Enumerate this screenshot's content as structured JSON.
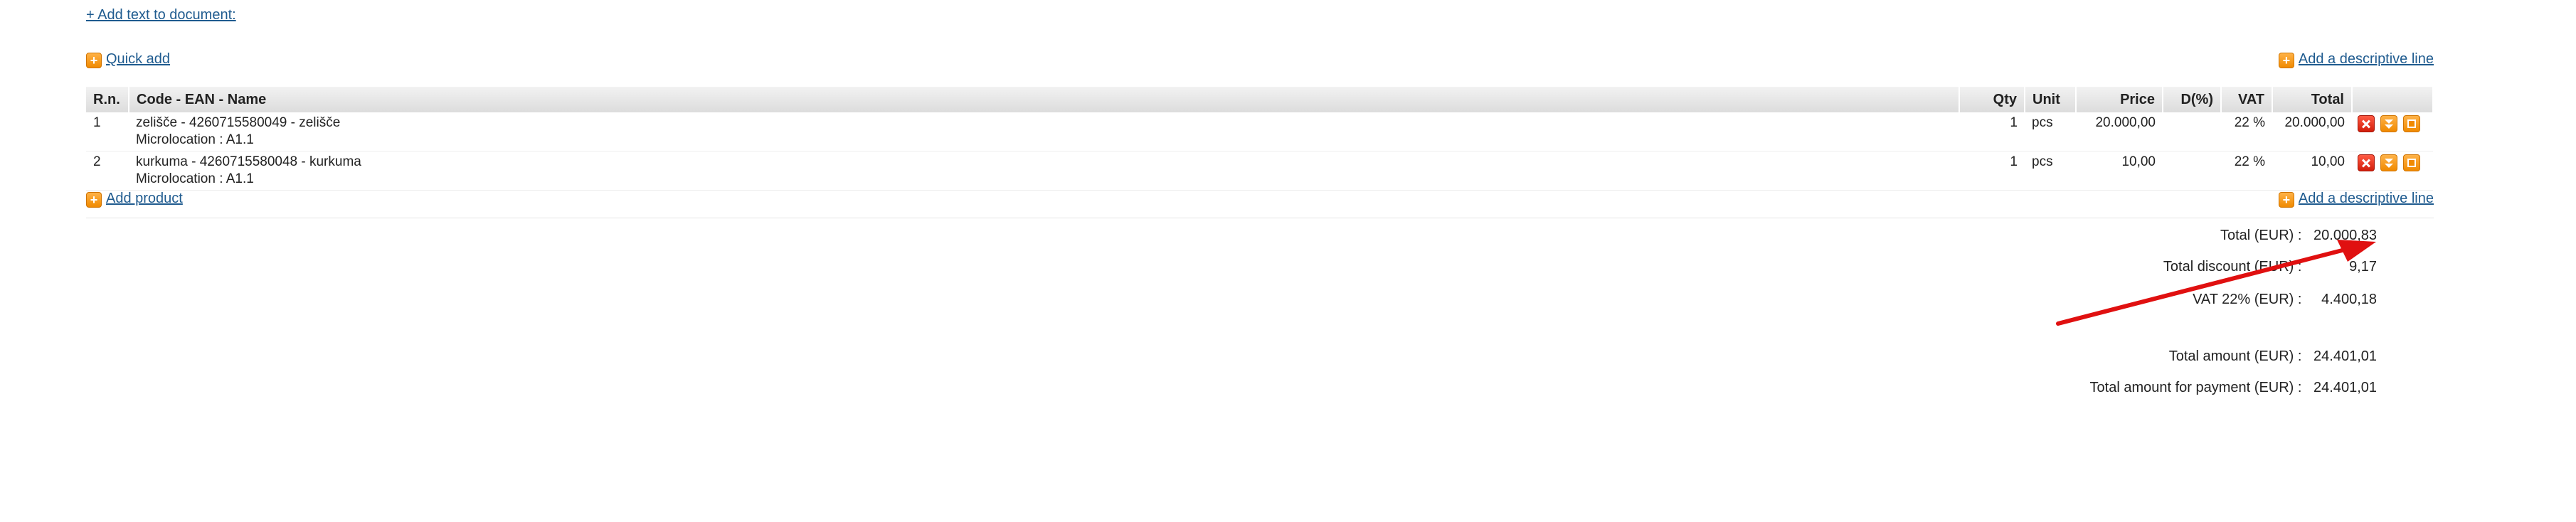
{
  "links": {
    "add_text": "+ Add text to document:",
    "quick_add": "Quick add",
    "add_descriptive_line": "Add a descriptive line",
    "add_product": "Add product"
  },
  "table": {
    "headers": [
      "R.n.",
      "Code - EAN - Name",
      "Qty",
      "Unit",
      "Price",
      "D(%)",
      "VAT",
      "Total"
    ],
    "rows": [
      {
        "rn": "1",
        "name": "zelišče - 4260715580049 - zelišče",
        "microlocation": "Microlocation : A1.1",
        "qty": "1",
        "unit": "pcs",
        "price": "20.000,00",
        "discount": "",
        "vat": "22 %",
        "total": "20.000,00"
      },
      {
        "rn": "2",
        "name": "kurkuma - 4260715580048 - kurkuma",
        "microlocation": "Microlocation : A1.1",
        "qty": "1",
        "unit": "pcs",
        "price": "10,00",
        "discount": "",
        "vat": "22 %",
        "total": "10,00"
      }
    ]
  },
  "totals": {
    "total_label": "Total (EUR) :",
    "total_value": "20.000,83",
    "discount_label": "Total discount (EUR) :",
    "discount_value": "9,17",
    "vat_label": "VAT 22% (EUR) :",
    "vat_value": "4.400,18",
    "amount_label": "Total amount (EUR) :",
    "amount_value": "24.401,01",
    "payment_label": "Total amount for payment (EUR) :",
    "payment_value": "24.401,01"
  },
  "icons": {
    "add": "plus-icon",
    "delete": "delete-icon",
    "move": "move-down-icon",
    "edit": "edit-icon"
  },
  "colors": {
    "link": "#1f5b8f",
    "accent_orange": "#f08a00",
    "delete_red": "#d21e0b",
    "annotation_arrow": "#e01010",
    "header_bg": "#dcdcdc"
  }
}
